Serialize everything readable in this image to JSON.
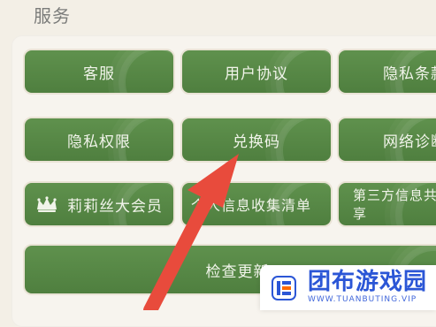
{
  "section": {
    "title": "服务"
  },
  "tiles": {
    "row1": [
      {
        "label": "客服"
      },
      {
        "label": "用户协议"
      },
      {
        "label": "隐私条款"
      }
    ],
    "row2": [
      {
        "label": "隐私权限"
      },
      {
        "label": "兑换码"
      },
      {
        "label": "网络诊断"
      }
    ],
    "row3": [
      {
        "label": "莉莉丝大会员",
        "icon": "crown-icon"
      },
      {
        "label": "个人信息收集清单"
      },
      {
        "label": "第三方信息共享"
      }
    ],
    "row4": [
      {
        "label": "检查更新"
      }
    ]
  },
  "watermark": {
    "cn": "团布游戏园",
    "en": "WWW.TUANBUTING.VIP",
    "accent": "#2b56d6"
  },
  "colors": {
    "tile": "#5f914d",
    "background": "#f3efe6",
    "arrow": "#e84b3c"
  }
}
